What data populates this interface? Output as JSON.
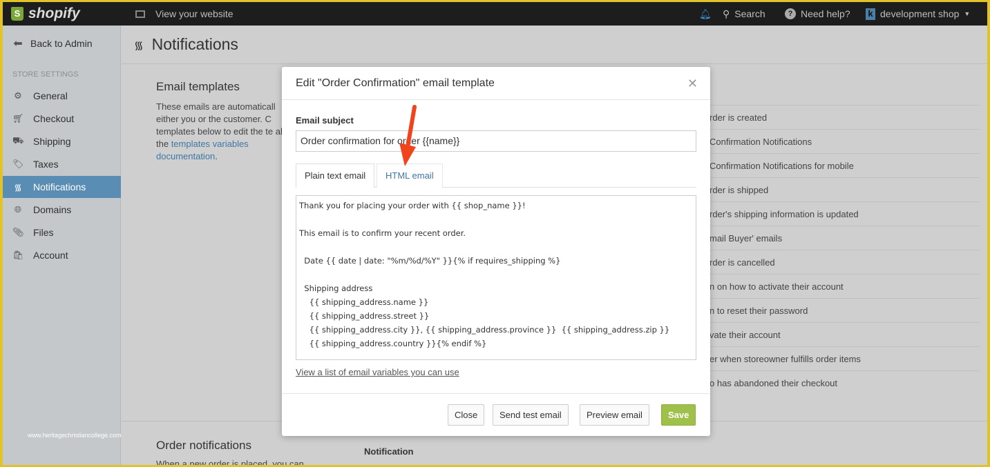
{
  "topbar": {
    "brand": "shopify",
    "view_site": "View your website",
    "search": "Search",
    "help": "Need help?",
    "shop": "development shop",
    "shop_initial": "k"
  },
  "sidebar": {
    "back": "Back to Admin",
    "section": "STORE SETTINGS",
    "items": [
      {
        "label": "General",
        "icon": "gear-icon"
      },
      {
        "label": "Checkout",
        "icon": "cart-icon"
      },
      {
        "label": "Shipping",
        "icon": "truck-icon"
      },
      {
        "label": "Taxes",
        "icon": "tag-icon"
      },
      {
        "label": "Notifications",
        "icon": "wifi-icon",
        "active": true
      },
      {
        "label": "Domains",
        "icon": "globe-icon"
      },
      {
        "label": "Files",
        "icon": "paperclip-icon"
      },
      {
        "label": "Account",
        "icon": "bag-icon"
      }
    ]
  },
  "page": {
    "title": "Notifications",
    "email_templates": {
      "title": "Email templates",
      "text": "These emails are automaticall either you or the customer. C templates below to edit the te also the ",
      "link": "templates variables documentation",
      "end": "."
    },
    "rows": [
      "rder is created",
      "Confirmation Notifications",
      "Confirmation Notifications for mobile",
      "rder is shipped",
      "rder's shipping information is updated",
      "mail Buyer' emails",
      "rder is cancelled",
      "n on how to activate their account",
      "n to reset their password",
      "vate their account",
      "er when storeowner fulfills order items",
      "o has abandoned their checkout"
    ],
    "order_notifications": {
      "title": "Order notifications",
      "text": "When a new order is placed, you can",
      "column": "Notification"
    },
    "watermark": "www.heritagechristiancollege.com"
  },
  "modal": {
    "title": "Edit \"Order Confirmation\" email template",
    "subject_label": "Email subject",
    "subject_value": "Order confirmation for order {{name}}",
    "tabs": [
      "Plain text email",
      "HTML email"
    ],
    "body": "Thank you for placing your order with {{ shop_name }}!\n\nThis email is to confirm your recent order.\n\n  Date {{ date | date: \"%m/%d/%Y\" }}{% if requires_shipping %}\n\n  Shipping address\n    {{ shipping_address.name }}\n    {{ shipping_address.street }}\n    {{ shipping_address.city }}, {{ shipping_address.province }}  {{ shipping_address.zip }}\n    {{ shipping_address.country }}{% endif %}",
    "variables_link": "View a list of email variables you can use",
    "buttons": {
      "close": "Close",
      "test": "Send test email",
      "preview": "Preview email",
      "save": "Save"
    }
  },
  "colors": {
    "accent": "#5a8db3",
    "save": "#9fc04a",
    "arrow": "#f0441c"
  }
}
